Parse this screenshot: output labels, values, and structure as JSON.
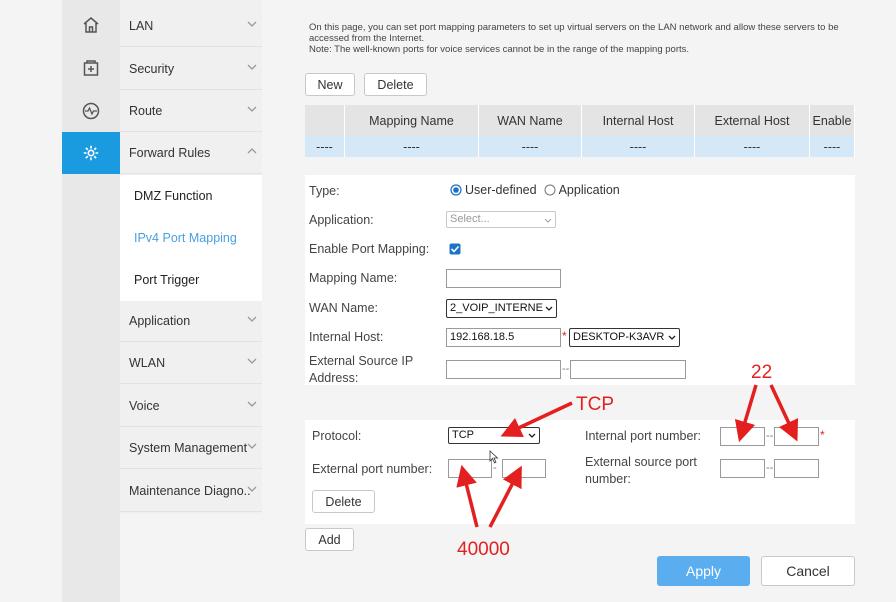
{
  "rail": {
    "icons": [
      "home-icon",
      "add-box-icon",
      "diagnostic-icon",
      "settings-icon"
    ],
    "active_color": "#1a9be0"
  },
  "sidebar": {
    "items": [
      {
        "label": "LAN"
      },
      {
        "label": "Security"
      },
      {
        "label": "Route"
      },
      {
        "label": "Forward Rules"
      },
      {
        "label": "Application"
      },
      {
        "label": "WLAN"
      },
      {
        "label": "Voice"
      },
      {
        "label": "System Management"
      },
      {
        "label": "Maintenance Diagno.."
      }
    ],
    "sub_items": [
      {
        "label": "DMZ Function"
      },
      {
        "label": "IPv4 Port Mapping"
      },
      {
        "label": "Port Trigger"
      }
    ]
  },
  "main": {
    "notice_line1": "On this page, you can set port mapping parameters to set up virtual servers on the LAN network and allow these servers to be accessed from the Internet.",
    "notice_line2": "Note: The well-known ports for voice services cannot be in the range of the mapping ports.",
    "new_label": "New",
    "delete_label": "Delete",
    "table": {
      "headers": [
        "",
        "Mapping Name",
        "WAN Name",
        "Internal Host",
        "External Host",
        "Enable"
      ],
      "row": [
        "----",
        "----",
        "----",
        "----",
        "----",
        "----"
      ]
    },
    "form": {
      "type_label": "Type:",
      "type_option1": "User-defined",
      "type_option2": "Application",
      "application_label": "Application:",
      "application_placeholder": "Select...",
      "enable_label": "Enable Port Mapping:",
      "mapping_name_label": "Mapping Name:",
      "mapping_name_value": "",
      "wan_name_label": "WAN Name:",
      "wan_name_value": "2_VOIP_INTERNE",
      "internal_host_label": "Internal Host:",
      "internal_host_value": "192.168.18.5",
      "internal_host_device": "DESKTOP-K3AVR",
      "ext_src_ip_label_1": "External Source IP",
      "ext_src_ip_label_2": "Address:"
    },
    "protocol": {
      "protocol_label": "Protocol:",
      "protocol_value": "TCP",
      "internal_port_label": "Internal port number:",
      "external_port_label": "External port number:",
      "ext_src_port_label_1": "External source port",
      "ext_src_port_label_2": "number:",
      "delete_label": "Delete"
    },
    "add_label": "Add",
    "apply_label": "Apply",
    "cancel_label": "Cancel"
  },
  "annotations": {
    "tcp": "TCP",
    "internal_port": "22",
    "external_port": "40000",
    "color": "#e41f1f"
  }
}
